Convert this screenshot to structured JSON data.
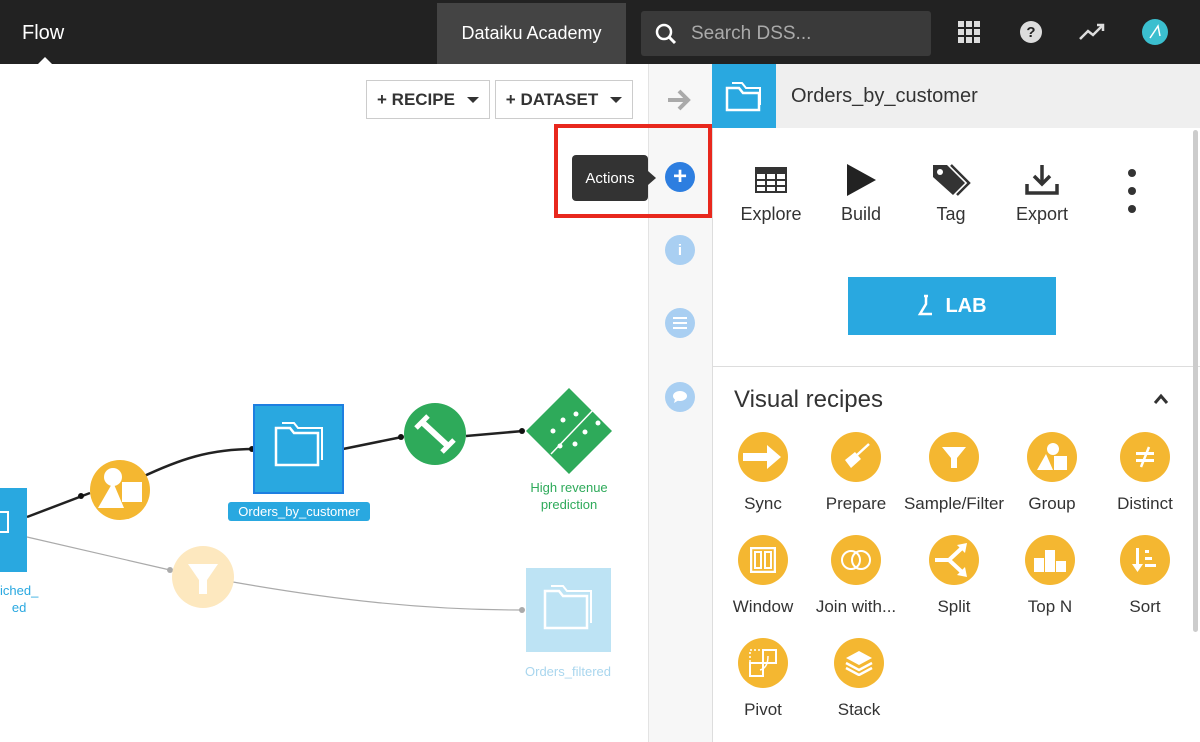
{
  "topbar": {
    "title": "Flow",
    "project": "Dataiku Academy",
    "search_placeholder": "Search DSS...",
    "icons": [
      "search-icon",
      "apps-grid-icon",
      "help-icon",
      "activity-icon",
      "avatar"
    ]
  },
  "canvas": {
    "recipe_button": "+ RECIPE",
    "dataset_button": "+ DATASET",
    "nodes": {
      "left_dataset_line1": "iched_",
      "left_dataset_line2": "ed",
      "orders_by_customer": "Orders_by_customer",
      "model_line1": "High revenue",
      "model_line2": "prediction",
      "orders_filtered": "Orders_filtered"
    }
  },
  "strip": {
    "tooltip": "Actions"
  },
  "panel": {
    "title": "Orders_by_customer",
    "actions": [
      "Explore",
      "Build",
      "Tag",
      "Export"
    ],
    "lab_label": "LAB",
    "section_title": "Visual recipes",
    "recipes": [
      "Sync",
      "Prepare",
      "Sample/Filter",
      "Group",
      "Distinct",
      "Window",
      "Join with...",
      "Split",
      "Top N",
      "Sort",
      "Pivot",
      "Stack"
    ]
  },
  "colors": {
    "topbar": "#222222",
    "accent_blue": "#29a8e0",
    "recipe_yellow": "#f4b731",
    "model_green": "#2eaa5a",
    "highlight_red": "#e8281d"
  }
}
